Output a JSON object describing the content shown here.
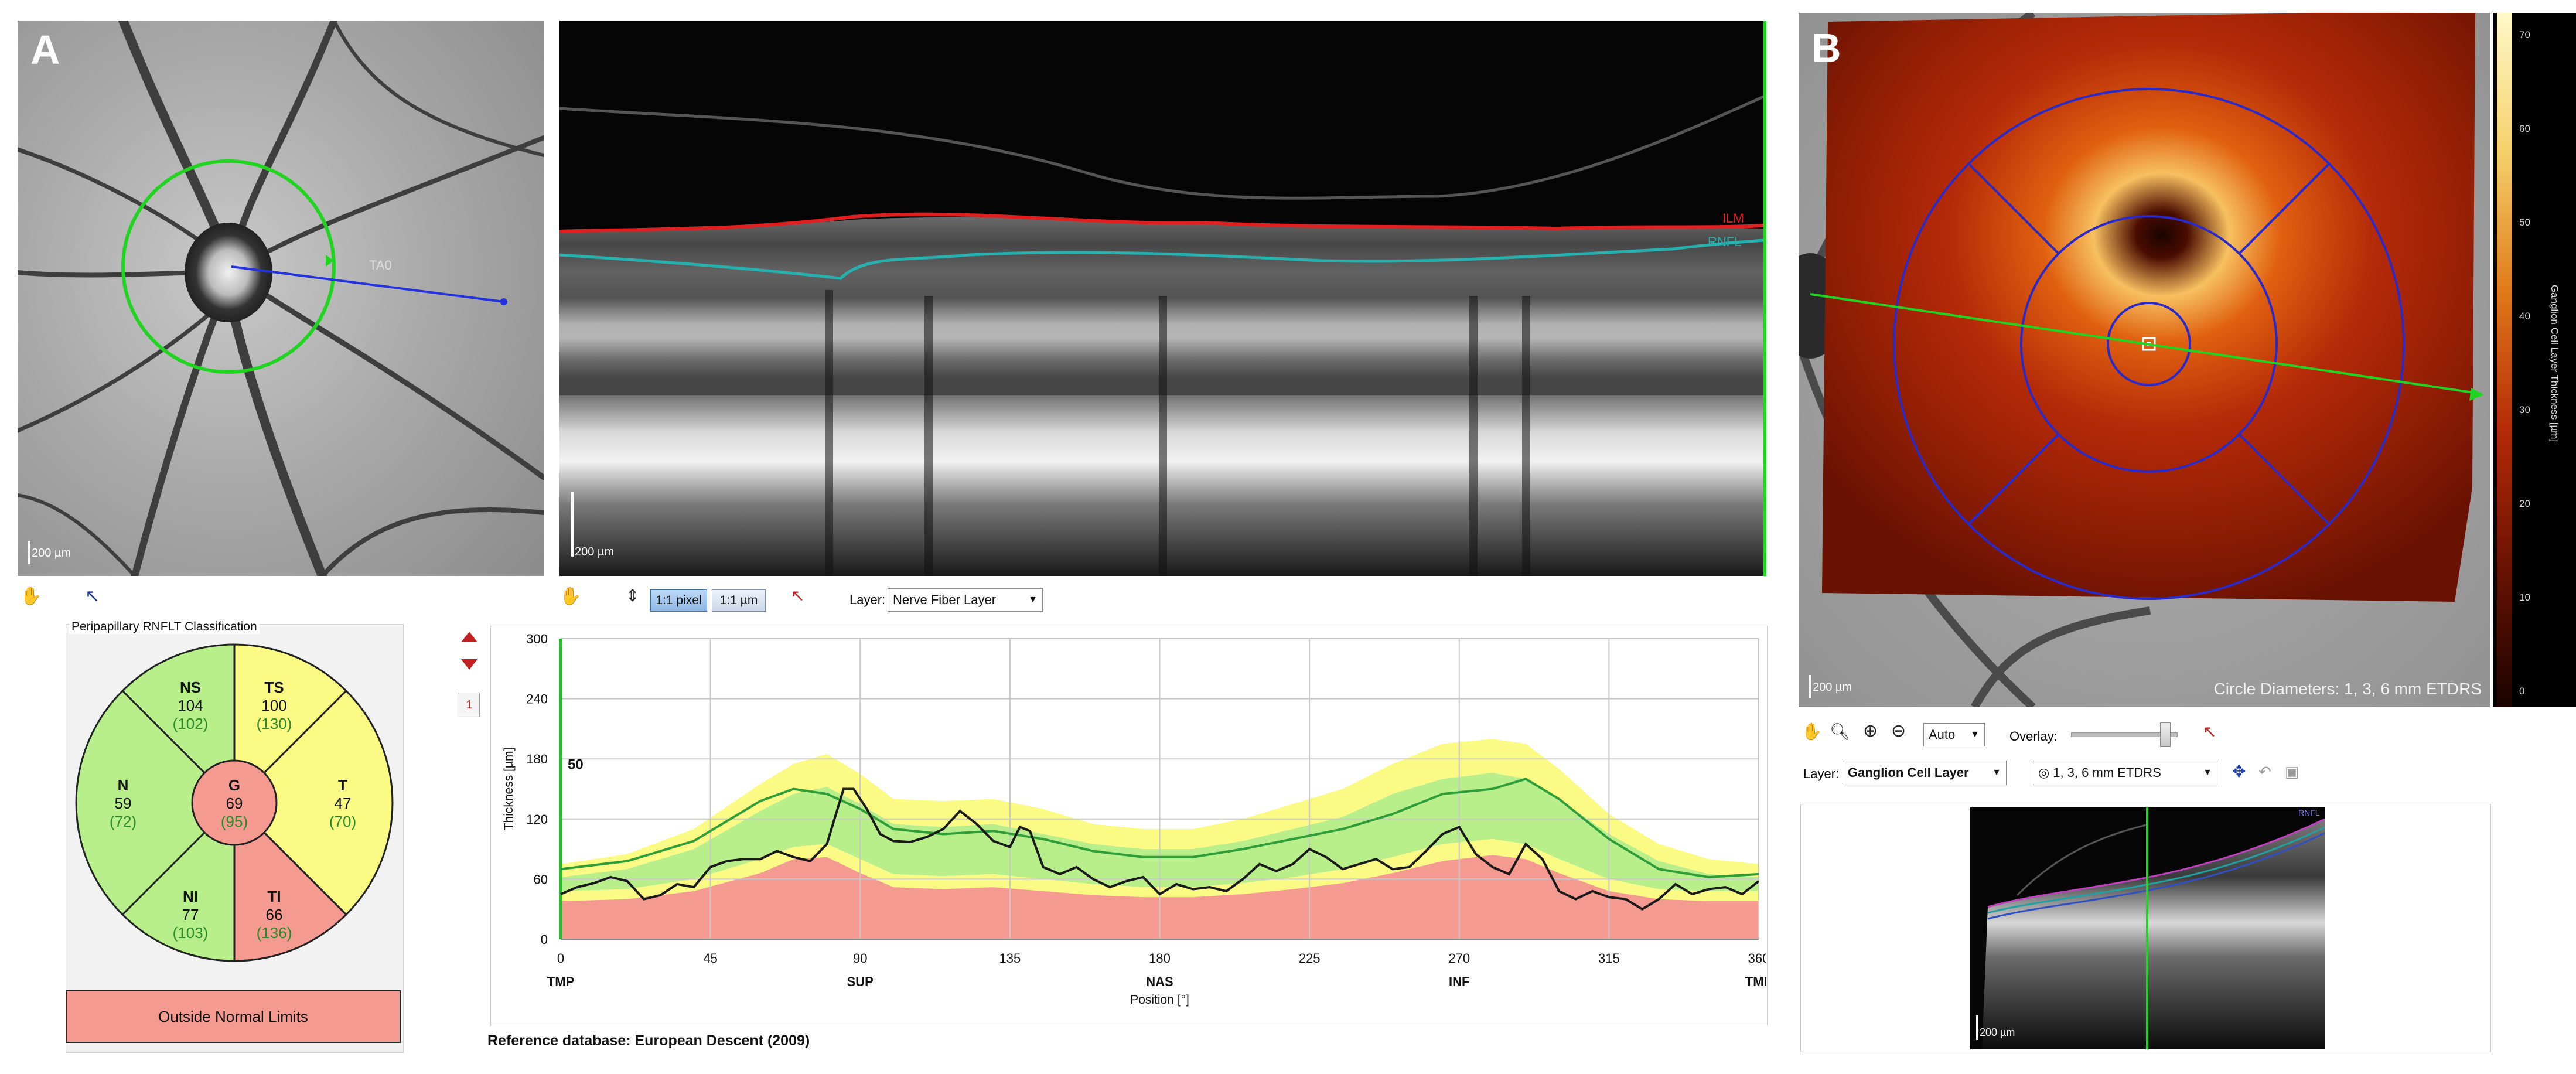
{
  "panel_a": {
    "letter": "A",
    "fundus_scale": "200 µm",
    "octline_label": "TA0",
    "bscan_scale": "200 µm",
    "bscan_layers": {
      "ilm": "ILM",
      "rnfl": "RNFL"
    }
  },
  "toolbar_a": {
    "zoom_1to1_pixel": "1:1 pixel",
    "zoom_1to1_um": "1:1 µm",
    "layer_label": "Layer:",
    "layer_value": "Nerve Fiber Layer"
  },
  "classification": {
    "title": "Peripapillary RNFLT Classification",
    "sectors": [
      {
        "id": "NS",
        "name": "NS",
        "value": "104",
        "ref": "(102)"
      },
      {
        "id": "TS",
        "name": "TS",
        "value": "100",
        "ref": "(130)"
      },
      {
        "id": "N",
        "name": "N",
        "value": "59",
        "ref": "(72)"
      },
      {
        "id": "G",
        "name": "G",
        "value": "69",
        "ref": "(95)"
      },
      {
        "id": "T",
        "name": "T",
        "value": "47",
        "ref": "(70)"
      },
      {
        "id": "NI",
        "name": "NI",
        "value": "77",
        "ref": "(103)"
      },
      {
        "id": "TI",
        "name": "TI",
        "value": "66",
        "ref": "(136)"
      }
    ],
    "result": "Outside Normal Limits",
    "colors": {
      "normal": "#b8ef8a",
      "borderline": "#fafa84",
      "outside": "#f59a90"
    }
  },
  "side_controls": {
    "page_number": "1"
  },
  "reference_database": "Reference database: European Descent (2009)",
  "chart_data": {
    "type": "line",
    "ylabel": "Thickness [µm]",
    "xlabel": "Position [°]",
    "ylim": [
      0,
      300
    ],
    "xlim": [
      0,
      360
    ],
    "yticks": [
      0,
      60,
      120,
      180,
      240,
      300
    ],
    "xticks": [
      0,
      45,
      90,
      135,
      180,
      225,
      270,
      315,
      360
    ],
    "sector_labels": [
      {
        "x": 0,
        "label": "TMP"
      },
      {
        "x": 90,
        "label": "SUP"
      },
      {
        "x": 180,
        "label": "NAS"
      },
      {
        "x": 270,
        "label": "INF"
      },
      {
        "x": 360,
        "label": "TMP"
      }
    ],
    "annotation": {
      "x": 0,
      "label": "50"
    },
    "grid": true,
    "bands": {
      "x": [
        0,
        20,
        40,
        60,
        70,
        80,
        90,
        100,
        115,
        130,
        145,
        160,
        175,
        190,
        205,
        220,
        235,
        250,
        265,
        280,
        290,
        300,
        315,
        330,
        345,
        360
      ],
      "p99": [
        75,
        85,
        110,
        155,
        175,
        185,
        165,
        140,
        138,
        140,
        130,
        115,
        110,
        110,
        120,
        135,
        150,
        175,
        195,
        200,
        195,
        170,
        125,
        95,
        80,
        75
      ],
      "p95": [
        62,
        70,
        90,
        128,
        145,
        152,
        135,
        115,
        112,
        115,
        105,
        95,
        90,
        90,
        98,
        110,
        122,
        145,
        160,
        166,
        160,
        140,
        105,
        78,
        65,
        62
      ],
      "p5": [
        48,
        50,
        60,
        80,
        92,
        95,
        80,
        65,
        63,
        65,
        60,
        55,
        52,
        52,
        56,
        62,
        70,
        82,
        95,
        100,
        95,
        80,
        60,
        50,
        48,
        48
      ],
      "p1": [
        38,
        40,
        48,
        66,
        80,
        82,
        66,
        52,
        50,
        52,
        48,
        44,
        42,
        42,
        45,
        50,
        56,
        66,
        78,
        84,
        80,
        66,
        48,
        40,
        38,
        38
      ]
    },
    "series": [
      {
        "values_x": [
          0,
          20,
          40,
          60,
          70,
          80,
          90,
          100,
          115,
          130,
          145,
          160,
          175,
          190,
          205,
          220,
          235,
          250,
          265,
          280,
          290,
          300,
          315,
          330,
          345,
          360
        ],
        "values_y": [
          70,
          78,
          98,
          138,
          150,
          145,
          130,
          110,
          105,
          108,
          100,
          88,
          82,
          82,
          90,
          100,
          110,
          125,
          145,
          150,
          160,
          140,
          100,
          70,
          62,
          65
        ],
        "color": "#2f9e3a",
        "role": "mean"
      },
      {
        "values_x": [
          0,
          5,
          10,
          15,
          20,
          25,
          30,
          35,
          40,
          45,
          50,
          55,
          60,
          65,
          70,
          75,
          80,
          85,
          88,
          92,
          96,
          100,
          105,
          110,
          115,
          120,
          125,
          130,
          135,
          138,
          141,
          145,
          150,
          155,
          160,
          165,
          170,
          175,
          180,
          185,
          190,
          195,
          200,
          205,
          210,
          215,
          220,
          225,
          230,
          235,
          240,
          245,
          250,
          255,
          260,
          265,
          270,
          275,
          280,
          285,
          290,
          295,
          300,
          305,
          310,
          315,
          320,
          325,
          330,
          335,
          340,
          345,
          350,
          355,
          360
        ],
        "values_y": [
          45,
          52,
          56,
          62,
          58,
          40,
          44,
          55,
          52,
          72,
          78,
          80,
          80,
          88,
          82,
          78,
          95,
          150,
          150,
          130,
          105,
          98,
          97,
          102,
          110,
          128,
          115,
          98,
          92,
          112,
          108,
          72,
          65,
          72,
          60,
          52,
          58,
          62,
          45,
          55,
          50,
          52,
          48,
          60,
          75,
          68,
          75,
          90,
          82,
          70,
          75,
          80,
          70,
          72,
          88,
          105,
          112,
          85,
          72,
          65,
          95,
          80,
          48,
          40,
          48,
          42,
          40,
          30,
          40,
          55,
          45,
          50,
          52,
          45,
          58
        ],
        "color": "#1a1a1a",
        "role": "patient"
      }
    ]
  },
  "panel_b": {
    "letter": "B",
    "fundus_scale": "200 µm",
    "grid_caption": "Circle Diameters: 1, 3, 6 mm ETDRS",
    "colorbar_title": "Ganglion Cell Layer Thickness [µm]",
    "colorbar_ticks": [
      "70",
      "60",
      "50",
      "40",
      "30",
      "20",
      "10",
      "0"
    ],
    "bscan_scale": "200 µm",
    "bscan_layer": "RNFL"
  },
  "toolbar_b": {
    "auto_value": "Auto",
    "overlay_label": "Overlay:",
    "overlay_level": 0.92,
    "layer_label": "Layer:",
    "layer_value": "Ganglion Cell Layer",
    "grid_value": "1, 3, 6 mm ETDRS"
  }
}
